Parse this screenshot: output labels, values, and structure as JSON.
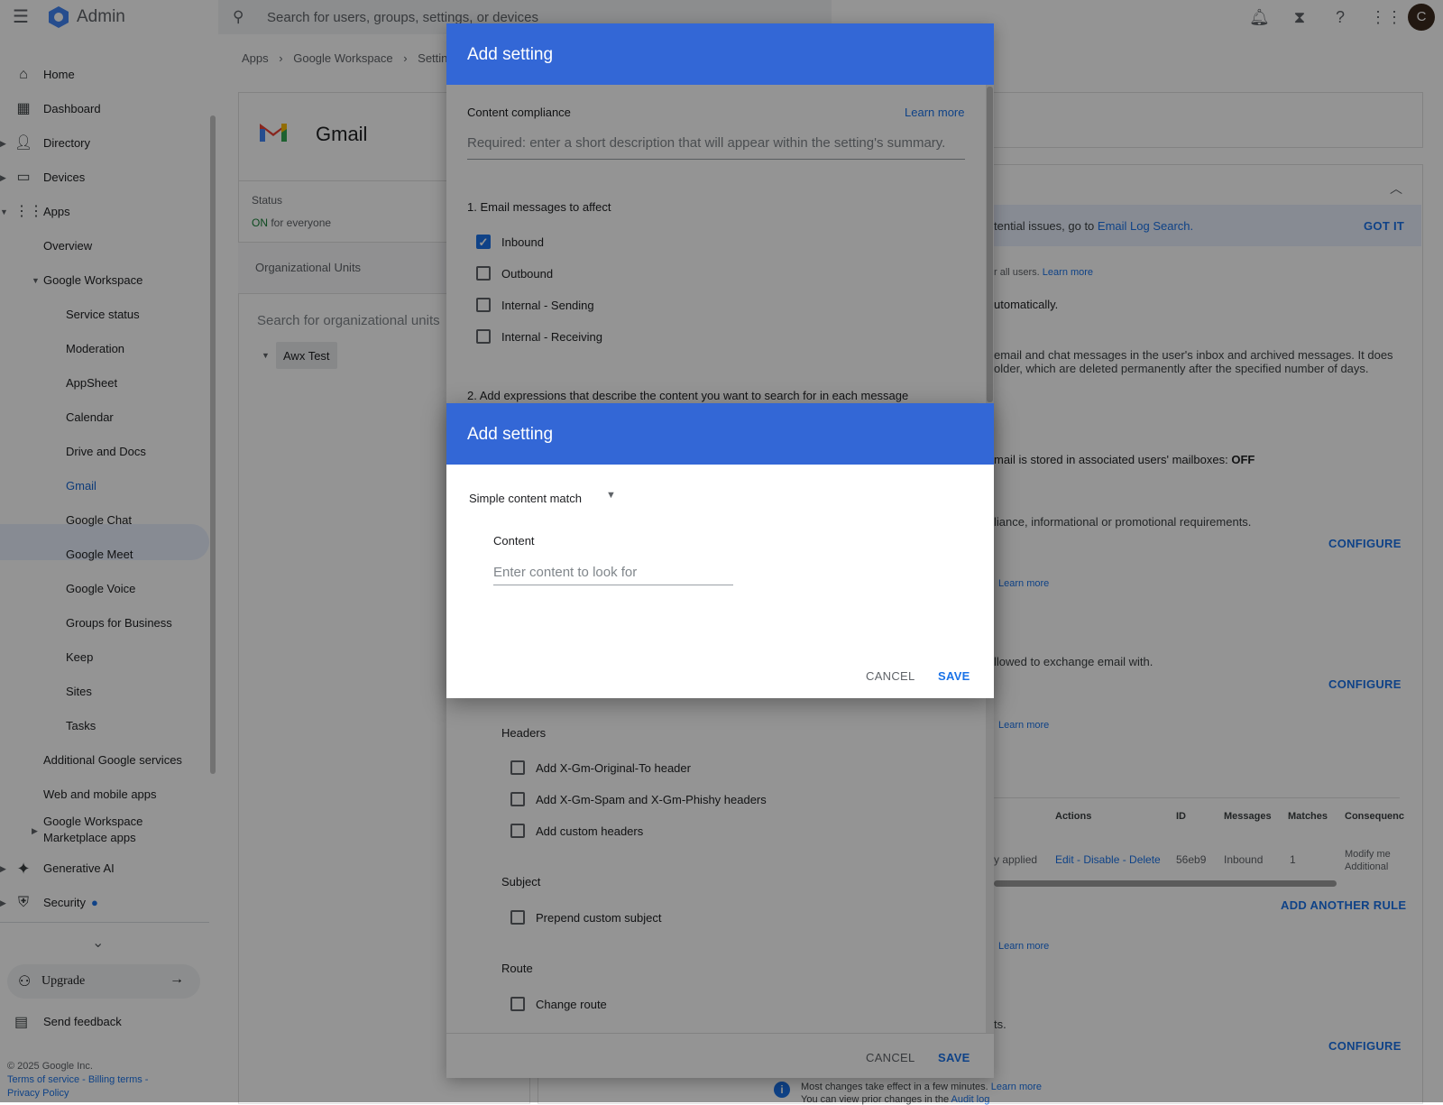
{
  "topbar": {
    "brand": "Admin",
    "search_placeholder": "Search for users, groups, settings, or devices",
    "avatar_letter": "C"
  },
  "breadcrumb": [
    "Apps",
    "Google Workspace",
    "Setting"
  ],
  "sidebar": {
    "items": [
      {
        "label": "Home"
      },
      {
        "label": "Dashboard"
      },
      {
        "label": "Directory"
      },
      {
        "label": "Devices"
      },
      {
        "label": "Apps"
      },
      {
        "label": "Overview"
      },
      {
        "label": "Google Workspace"
      },
      {
        "label": "Service status"
      },
      {
        "label": "Moderation"
      },
      {
        "label": "AppSheet"
      },
      {
        "label": "Calendar"
      },
      {
        "label": "Drive and Docs"
      },
      {
        "label": "Gmail"
      },
      {
        "label": "Google Chat"
      },
      {
        "label": "Google Meet"
      },
      {
        "label": "Google Voice"
      },
      {
        "label": "Groups for Business"
      },
      {
        "label": "Keep"
      },
      {
        "label": "Sites"
      },
      {
        "label": "Tasks"
      },
      {
        "label": "Additional Google services"
      },
      {
        "label": "Web and mobile apps"
      },
      {
        "label": "Google Workspace"
      },
      {
        "label": "Marketplace apps"
      },
      {
        "label": "Generative AI"
      },
      {
        "label": "Security"
      }
    ],
    "upgrade": "Upgrade",
    "feedback": "Send feedback",
    "copyright": "© 2025 Google Inc.",
    "terms": "Terms of service - Billing terms -",
    "privacy": "Privacy Policy"
  },
  "gmail_panel": {
    "title": "Gmail",
    "status_label": "Status",
    "status_on": "ON",
    "status_rest": " for everyone",
    "org_units": "Organizational Units",
    "org_search": "Search for organizational units",
    "org_root": "Awx Test"
  },
  "background": {
    "t1": "tential issues, go to ",
    "t1_link": "Email Log Search.",
    "got_it": "GOT IT",
    "t2": "r all users. ",
    "learn_more": "Learn more",
    "t3": "utomatically.",
    "t4": "email and chat messages in the user's inbox and archived messages. It does",
    "t5": "older, which are deleted permanently after the specified number of days.",
    "t6": "mail is stored in associated users' mailboxes: ",
    "t6b": "OFF",
    "t7": "liance, informational or promotional requirements.",
    "configure": "CONFIGURE",
    "t8": "llowed to exchange email with.",
    "table_headers": [
      "Actions",
      "ID",
      "Messages",
      "Matches",
      "Consequenc"
    ],
    "row": {
      "applied": "y applied",
      "actions": "Edit - Disable - Delete",
      "id": "56eb9",
      "messages": "Inbound",
      "matches": "1",
      "consequence": "Modify me",
      "consequence2": "Additional"
    },
    "add_rule": "ADD ANOTHER RULE",
    "t9": "ts.",
    "notice1": "Most changes take effect in a few minutes. ",
    "notice2": "You can view prior changes in the ",
    "audit": "Audit log"
  },
  "dialog1": {
    "title": "Add setting",
    "section": "Content compliance",
    "learn_more": "Learn more",
    "description_placeholder": "Required: enter a short description that will appear within the setting's summary.",
    "step1": "1. Email messages to affect",
    "affect": [
      {
        "label": "Inbound",
        "checked": true
      },
      {
        "label": "Outbound",
        "checked": false
      },
      {
        "label": "Internal - Sending",
        "checked": false
      },
      {
        "label": "Internal - Receiving",
        "checked": false
      }
    ],
    "step2": "2. Add expressions that describe the content you want to search for in each message",
    "headers_title": "Headers",
    "headers": [
      {
        "label": "Add X-Gm-Original-To header",
        "checked": false
      },
      {
        "label": "Add X-Gm-Spam and X-Gm-Phishy headers",
        "checked": false
      },
      {
        "label": "Add custom headers",
        "checked": false
      }
    ],
    "subject_title": "Subject",
    "subject_option": "Prepend custom subject",
    "route_title": "Route",
    "route_option": "Change route",
    "cancel": "CANCEL",
    "save": "SAVE"
  },
  "dialog2": {
    "title": "Add setting",
    "match_type": "Simple content match",
    "content_label": "Content",
    "content_placeholder": "Enter content to look for",
    "cancel": "CANCEL",
    "save": "SAVE"
  },
  "colors": {
    "header_blue": "#3367d6",
    "accent": "#1a73e8"
  }
}
